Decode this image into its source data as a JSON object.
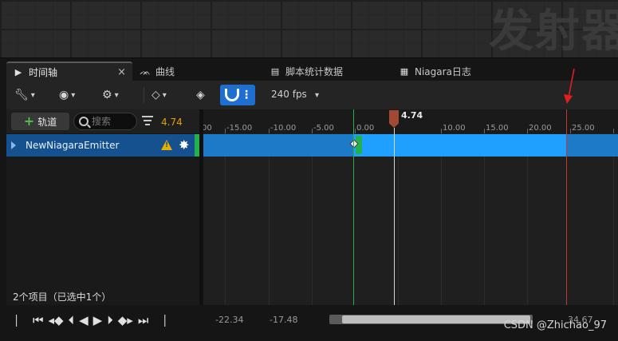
{
  "viewport": {
    "title": "发射器"
  },
  "tabs": [
    {
      "label": "时间轴",
      "icon": "timeline-icon",
      "active": true
    },
    {
      "label": "曲线",
      "icon": "curve-icon",
      "active": false
    },
    {
      "label": "脚本统计数据",
      "icon": "stats-icon",
      "active": false
    },
    {
      "label": "Niagara日志",
      "icon": "log-icon",
      "active": false
    }
  ],
  "tab_close": "×",
  "toolbar": {
    "fps": "240 fps"
  },
  "outliner": {
    "add_track_label": "轨道",
    "search_placeholder": "搜索",
    "current_time": "4.74",
    "track_name": "NewNiagaraEmitter",
    "status": "2个项目（已选中1个）"
  },
  "ruler": {
    "ticks": [
      "-15.00",
      "-10.00",
      "-5.00",
      "0.00",
      "10.00",
      "15.00",
      "20.00",
      "25.00"
    ],
    "playhead": "4.74"
  },
  "bottom": {
    "range_start": "-22.34",
    "view_start": "-17.48",
    "view_end": "34.67",
    "watermark": "CSDN @Zhichao_97"
  },
  "colors": {
    "accent": "#1e6fd0",
    "track": "#1d7ac9",
    "playhead": "#a04a35",
    "start": "#22b14c",
    "end": "#c0392b",
    "time": "#e0a000"
  }
}
